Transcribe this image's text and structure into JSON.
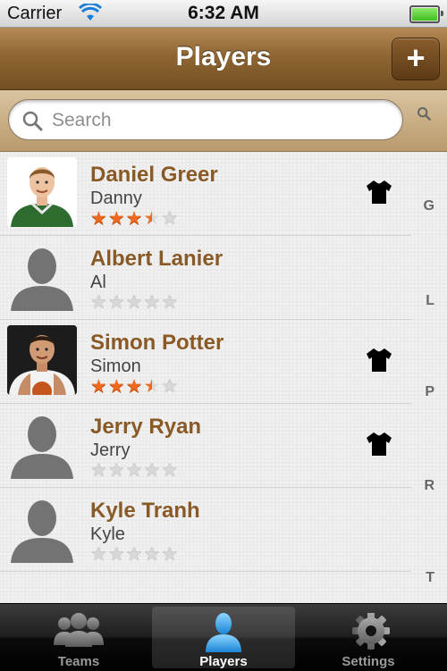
{
  "status_bar": {
    "carrier": "Carrier",
    "time": "6:32 AM"
  },
  "nav_bar": {
    "title": "Players",
    "add_button_label": "+"
  },
  "search": {
    "placeholder": "Search"
  },
  "players": [
    {
      "name": "Daniel Greer",
      "nickname": "Danny",
      "rating": 3.5,
      "stars": [
        "★",
        "★",
        "★",
        "★",
        "★"
      ],
      "avatar": "photo",
      "has_jersey": true
    },
    {
      "name": "Albert Lanier",
      "nickname": "Al",
      "rating": 0,
      "stars": [
        "★",
        "★",
        "★",
        "★",
        "★"
      ],
      "avatar": "placeholder",
      "has_jersey": false
    },
    {
      "name": "Simon Potter",
      "nickname": "Simon",
      "rating": 3.5,
      "stars": [
        "★",
        "★",
        "★",
        "★",
        "★"
      ],
      "avatar": "photo-dark",
      "has_jersey": true
    },
    {
      "name": "Jerry Ryan",
      "nickname": "Jerry",
      "rating": 0,
      "stars": [
        "★",
        "★",
        "★",
        "★",
        "★"
      ],
      "avatar": "placeholder",
      "has_jersey": true
    },
    {
      "name": "Kyle Tranh",
      "nickname": "Kyle",
      "rating": 0,
      "stars": [
        "★",
        "★",
        "★",
        "★",
        "★"
      ],
      "avatar": "placeholder",
      "has_jersey": false
    }
  ],
  "section_index": [
    "G",
    "L",
    "P",
    "R",
    "T"
  ],
  "tab_bar": {
    "tabs": [
      {
        "label": "Teams",
        "icon": "group-icon",
        "selected": false
      },
      {
        "label": "Players",
        "icon": "person-icon",
        "selected": true
      },
      {
        "label": "Settings",
        "icon": "gear-icon",
        "selected": false
      }
    ]
  },
  "colors": {
    "name_text": "#8a5a26",
    "star_on": "#ef6a21",
    "nav_brown": "#8f6633",
    "selected_tab_icon": "#2fa6e8"
  }
}
